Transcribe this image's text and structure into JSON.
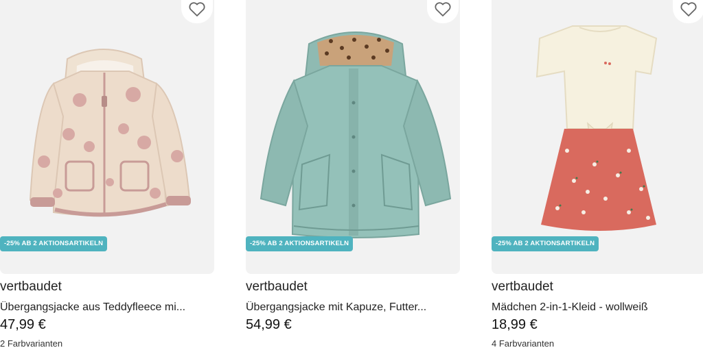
{
  "products": [
    {
      "promo": "-25% AB 2 AKTIONSARTIKELN",
      "brand": "vertbaudet",
      "title": "Übergangsjacke aus Teddyfleece mi...",
      "price": "47,99 €",
      "variants": "2 Farbvarianten"
    },
    {
      "promo": "-25% AB 2 AKTIONSARTIKELN",
      "brand": "vertbaudet",
      "title": "Übergangsjacke mit Kapuze, Futter...",
      "price": "54,99 €",
      "variants": ""
    },
    {
      "promo": "-25% AB 2 AKTIONSARTIKELN",
      "brand": "vertbaudet",
      "title": "Mädchen 2-in-1-Kleid - wollweiß",
      "price": "18,99 €",
      "variants": "4 Farbvarianten"
    }
  ],
  "icons": {
    "favorite": "heart-outline-icon"
  },
  "colors": {
    "promo_bg": "#4fb3bf",
    "image_bg": "#f2f2f2"
  }
}
